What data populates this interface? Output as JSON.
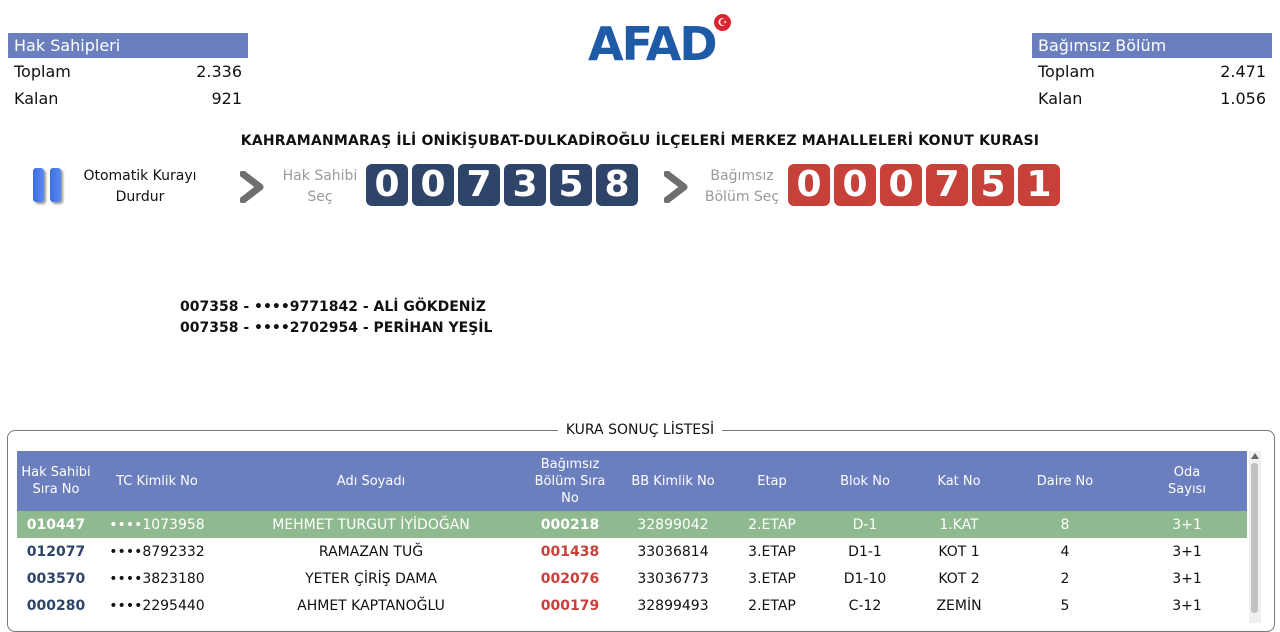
{
  "stats": {
    "hak": {
      "header": "Hak Sahipleri",
      "total_label": "Toplam",
      "total": "2.336",
      "remaining_label": "Kalan",
      "remaining": "921"
    },
    "bolum": {
      "header": "Bağımsız Bölüm",
      "total_label": "Toplam",
      "total": "2.471",
      "remaining_label": "Kalan",
      "remaining": "1.056"
    }
  },
  "logo": {
    "text": "AFAD",
    "icon": "turkish-flag-icon",
    "brand_color": "#1f5aa6"
  },
  "title": "KAHRAMANMARAŞ İLİ ONİKİŞUBAT-DULKADİROĞLU İLÇELERİ MERKEZ MAHALLELERİ KONUT KURASI",
  "controls": {
    "pause": {
      "line1": "Otomatik Kurayı",
      "line2": "Durdur",
      "icon": "pause-icon"
    },
    "hak_select": {
      "line1": "Hak Sahibi",
      "line2": "Seç",
      "digits": [
        "0",
        "0",
        "7",
        "3",
        "5",
        "8"
      ],
      "color": "#2f4469"
    },
    "bolum_select": {
      "line1": "Bağımsız",
      "line2": "Bölüm Seç",
      "digits": [
        "0",
        "0",
        "0",
        "7",
        "5",
        "1"
      ],
      "color": "#c8403a"
    }
  },
  "winners": [
    "007358 - ••••9771842 - ALİ GÖKDENİZ",
    "007358 - ••••2702954 - PERİHAN YEŞİL"
  ],
  "results": {
    "title": "KURA SONUÇ LİSTESİ",
    "headers": {
      "sira_a": "Hak Sahibi",
      "sira_b": "Sıra No",
      "tc": "TC Kimlik No",
      "ad": "Adı Soyadı",
      "bsira_a": "Bağımsız",
      "bsira_b": "Bölüm Sıra",
      "bsira_c": "No",
      "bb": "BB Kimlik No",
      "etap": "Etap",
      "blok": "Blok No",
      "kat": "Kat No",
      "daire": "Daire No",
      "oda_a": "Oda",
      "oda_b": "Sayısı"
    },
    "rows": [
      {
        "sira": "010447",
        "tc": "••••1073958",
        "ad": "MEHMET TURGUT İYİDOĞAN",
        "bsira": "000218",
        "bb": "32899042",
        "etap": "2.ETAP",
        "blok": "D-1",
        "kat": "1.KAT",
        "daire": "8",
        "oda": "3+1"
      },
      {
        "sira": "012077",
        "tc": "••••8792332",
        "ad": "RAMAZAN TUĞ",
        "bsira": "001438",
        "bb": "33036814",
        "etap": "3.ETAP",
        "blok": "D1-1",
        "kat": "KOT 1",
        "daire": "4",
        "oda": "3+1"
      },
      {
        "sira": "003570",
        "tc": "••••3823180",
        "ad": "YETER ÇİRİŞ DAMA",
        "bsira": "002076",
        "bb": "33036773",
        "etap": "3.ETAP",
        "blok": "D1-10",
        "kat": "KOT 2",
        "daire": "2",
        "oda": "3+1"
      },
      {
        "sira": "000280",
        "tc": "••••2295440",
        "ad": "AHMET KAPTANOĞLU",
        "bsira": "000179",
        "bb": "32899493",
        "etap": "2.ETAP",
        "blok": "C-12",
        "kat": "ZEMİN",
        "daire": "5",
        "oda": "3+1"
      }
    ]
  }
}
